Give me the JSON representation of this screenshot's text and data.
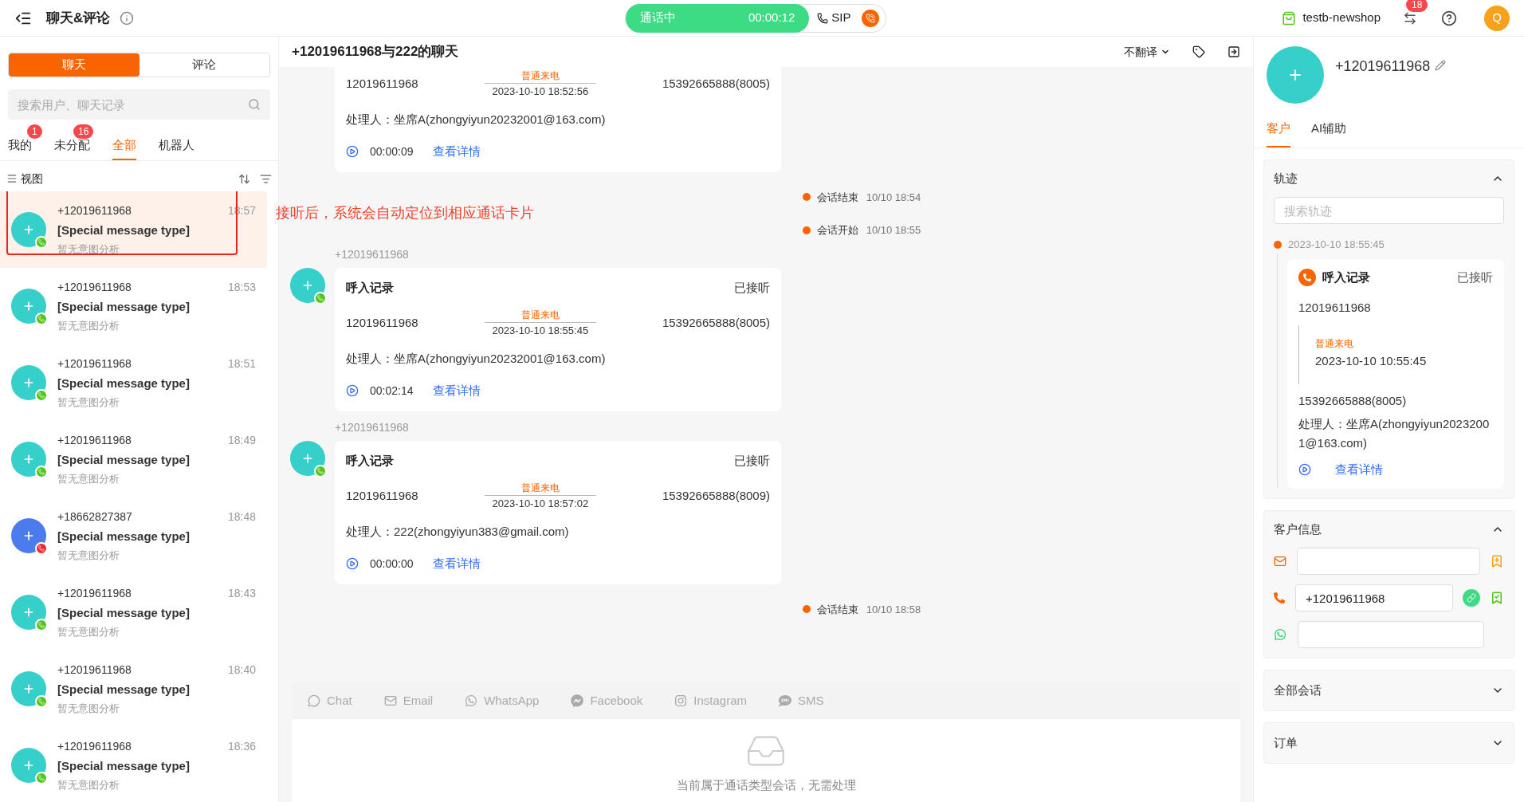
{
  "topbar": {
    "title": "聊天&评论",
    "call": {
      "status": "通话中",
      "timer": "00:00:12",
      "line": "SIP"
    },
    "shop": "testb-newshop",
    "notifications": "18",
    "user_initial": "Q"
  },
  "left": {
    "segments": [
      {
        "label": "聊天",
        "selected": true
      },
      {
        "label": "评论",
        "selected": false
      }
    ],
    "search": {
      "placeholder": "搜索用户、聊天记录"
    },
    "tabs": [
      {
        "label": "我的",
        "badge": "1",
        "selected": false
      },
      {
        "label": "未分配",
        "badge": "16",
        "selected": false
      },
      {
        "label": "全部",
        "selected": true
      },
      {
        "label": "机器人",
        "selected": false
      }
    ],
    "view_label": "视图",
    "conversations": [
      {
        "kind": "call",
        "name": "+12019611968",
        "time": "18:57",
        "message": "[Special message type]",
        "intent": "暂无意图分析",
        "selected": true,
        "color": "#36cfc9"
      },
      {
        "kind": "call",
        "name": "+12019611968",
        "time": "18:53",
        "message": "[Special message type]",
        "intent": "暂无意图分析",
        "selected": false,
        "color": "#36cfc9"
      },
      {
        "kind": "call",
        "name": "+12019611968",
        "time": "18:51",
        "message": "[Special message type]",
        "intent": "暂无意图分析",
        "selected": false,
        "color": "#36cfc9"
      },
      {
        "kind": "call",
        "name": "+12019611968",
        "time": "18:49",
        "message": "[Special message type]",
        "intent": "暂无意图分析",
        "selected": false,
        "color": "#36cfc9"
      },
      {
        "kind": "missed_call",
        "name": "+18662827387",
        "time": "18:48",
        "message": "[Special message type]",
        "intent": "暂无意图分析",
        "selected": false,
        "color": "#4b7bec"
      },
      {
        "kind": "call",
        "name": "+12019611968",
        "time": "18:43",
        "message": "[Special message type]",
        "intent": "暂无意图分析",
        "selected": false,
        "color": "#36cfc9"
      },
      {
        "kind": "call",
        "name": "+12019611968",
        "time": "18:40",
        "message": "[Special message type]",
        "intent": "暂无意图分析",
        "selected": false,
        "color": "#36cfc9"
      },
      {
        "kind": "call",
        "name": "+12019611968",
        "time": "18:36",
        "message": "[Special message type]",
        "intent": "暂无意图分析",
        "selected": false,
        "color": "#36cfc9"
      }
    ]
  },
  "annotation": {
    "text": "接听后，系统会自动定位到相应通话卡片"
  },
  "chat": {
    "title": "+12019611968与222的聊天",
    "translate": "不翻译",
    "messages": [
      {
        "kind": "call",
        "from": "12019611968",
        "call_type": "普通来电",
        "call_time": "2023-10-10 18:52:56",
        "to": "15392665888(8005)",
        "handler": "处理人：坐席A(zhongyiyun20232001@163.com)",
        "duration": "00:00:09",
        "link": "查看详情"
      },
      {
        "kind": "event",
        "label": "会话结束",
        "time": "10/10 18:54"
      },
      {
        "kind": "event",
        "label": "会话开始",
        "time": "10/10 18:55"
      },
      {
        "kind": "call",
        "sender": "+12019611968",
        "title": "呼入记录",
        "status": "已接听",
        "from": "12019611968",
        "call_type": "普通来电",
        "call_time": "2023-10-10 18:55:45",
        "to": "15392665888(8005)",
        "handler": "处理人：坐席A(zhongyiyun20232001@163.com)",
        "duration": "00:02:14",
        "link": "查看详情"
      },
      {
        "kind": "call",
        "sender": "+12019611968",
        "title": "呼入记录",
        "status": "已接听",
        "from": "12019611968",
        "call_type": "普通来电",
        "call_time": "2023-10-10 18:57:02",
        "to": "15392665888(8009)",
        "handler": "处理人：222(zhongyiyun383@gmail.com)",
        "duration": "00:00:00",
        "link": "查看详情"
      },
      {
        "kind": "event",
        "label": "会话结束",
        "time": "10/10 18:58"
      }
    ],
    "channels": [
      {
        "kind": "chat",
        "label": "Chat",
        "disabled": true
      },
      {
        "kind": "email",
        "label": "Email",
        "disabled": true
      },
      {
        "kind": "whatsapp",
        "label": "WhatsApp",
        "disabled": true
      },
      {
        "kind": "facebook",
        "label": "Facebook",
        "disabled": true
      },
      {
        "kind": "instagram",
        "label": "Instagram",
        "disabled": true
      },
      {
        "kind": "sms",
        "label": "SMS",
        "disabled": true
      }
    ],
    "empty_message": "当前属于通话类型会话，无需处理"
  },
  "right": {
    "name": "+12019611968",
    "tabs": [
      {
        "label": "客户",
        "selected": true
      },
      {
        "label": "AI辅助",
        "selected": false
      }
    ],
    "track": {
      "title": "轨迹",
      "expanded": true,
      "search_placeholder": "搜索轨迹",
      "entries": [
        {
          "time": "2023-10-10 18:55:45",
          "title": "呼入记录",
          "status": "已接听",
          "from": "12019611968",
          "call_type": "普通来电",
          "call_time": "2023-10-10 10:55:45",
          "to": "15392665888(8005)",
          "handler": "处理人：坐席A(zhongyiyun20232001@163.com)",
          "link": "查看详情"
        }
      ]
    },
    "customer_info": {
      "title": "客户信息",
      "expanded": true,
      "fields": [
        {
          "kind": "email"
        },
        {
          "kind": "phone",
          "value": "+12019611968"
        },
        {
          "kind": "whatsapp"
        }
      ]
    },
    "collapsed_sections": [
      {
        "title": "全部会话",
        "expanded": false
      },
      {
        "title": "订单",
        "expanded": false
      }
    ]
  }
}
